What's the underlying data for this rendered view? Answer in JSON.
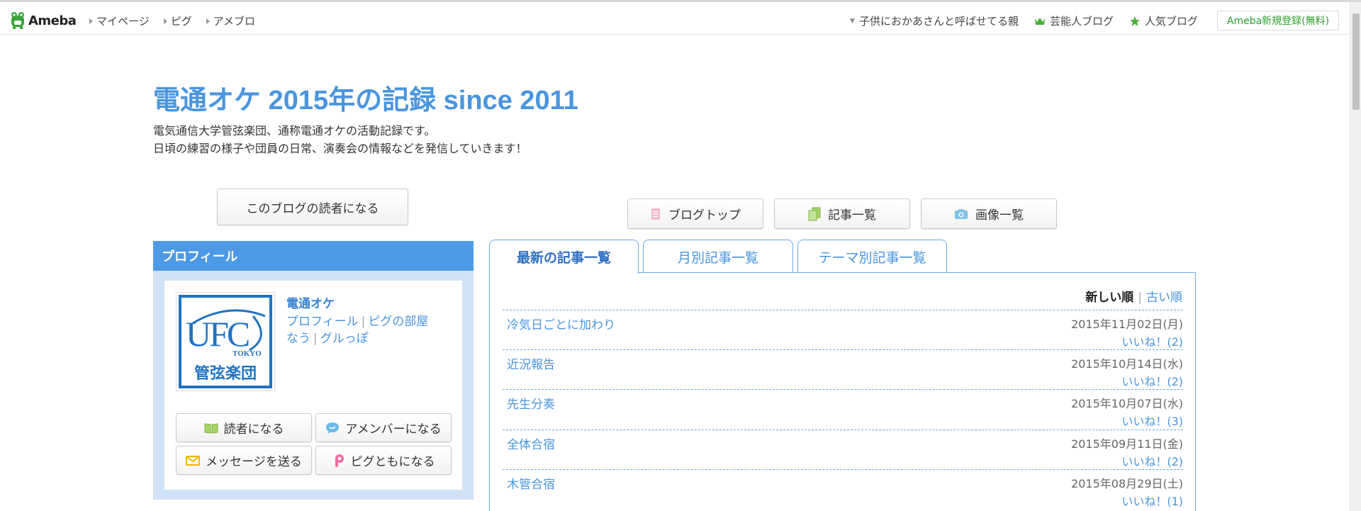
{
  "header": {
    "logo_text": "Ameba",
    "nav_left": [
      "マイページ",
      "ピグ",
      "アメブロ"
    ],
    "nav_right": {
      "dropdown_text": "子供におかあさんと呼ばせてる親",
      "celebrity": "芸能人ブログ",
      "popular": "人気ブログ"
    },
    "register_label": "Ameba新規登録(無料)"
  },
  "blog": {
    "title": "電通オケ 2015年の記録 since 2011",
    "desc_line1": "電気通信大学管弦楽団、通称電通オケの活動記録です。",
    "desc_line2": "日頃の練習の様子や団員の日常、演奏会の情報などを発信していきます！"
  },
  "subscribe_label": "このブログの読者になる",
  "nav_buttons": {
    "top": "ブログトップ",
    "list": "記事一覧",
    "images": "画像一覧"
  },
  "profile": {
    "heading": "プロフィール",
    "name": "電通オケ",
    "link_profile": "プロフィール",
    "link_room": "ピグの部屋",
    "link_nau": "なう",
    "link_gurupo": "グルっぽ",
    "avatar_text_ufc": "UFC",
    "avatar_text_tokyo": "TOKYO",
    "avatar_text_kanji": "管弦楽団",
    "btn_reader": "読者になる",
    "btn_amember": "アメンバーになる",
    "btn_message": "メッセージを送る",
    "btn_pig": "ピグともになる"
  },
  "tabs": [
    "最新の記事一覧",
    "月別記事一覧",
    "テーマ別記事一覧"
  ],
  "sort": {
    "new": "新しい順",
    "old": "古い順"
  },
  "entries": [
    {
      "title": "冷気日ごとに加わり",
      "date": "2015年11月02日(月)",
      "likes": "いいね！(2)"
    },
    {
      "title": "近況報告",
      "date": "2015年10月14日(水)",
      "likes": "いいね！(2)"
    },
    {
      "title": "先生分奏",
      "date": "2015年10月07日(水)",
      "likes": "いいね！(3)"
    },
    {
      "title": "全体合宿",
      "date": "2015年09月11日(金)",
      "likes": "いいね！(2)"
    },
    {
      "title": "木管合宿",
      "date": "2015年08月29日(土)",
      "likes": "いいね！(1)"
    }
  ],
  "colors": {
    "accent": "#4a95de",
    "profile_head": "#4c9ae6",
    "profile_bg": "#cfe2f6",
    "ameba_green": "#2d9c2d"
  }
}
